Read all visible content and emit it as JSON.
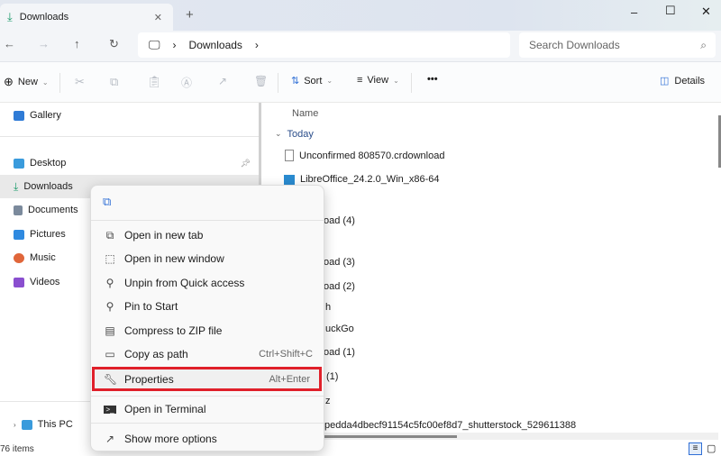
{
  "window": {
    "tab_title": "Downloads",
    "new_tab": "+",
    "minimize": "–",
    "maximize": "☐",
    "close": "✕"
  },
  "address": {
    "crumbs": [
      "Downloads"
    ],
    "search_placeholder": "Search Downloads"
  },
  "toolbar": {
    "new_label": "New",
    "sort_label": "Sort",
    "view_label": "View",
    "more": "•••",
    "details_label": "Details"
  },
  "sidebar": {
    "items": [
      {
        "label": "Gallery",
        "color": "#2f7bd6"
      },
      {
        "label": "Desktop",
        "color": "#3a9bdc"
      },
      {
        "label": "Downloads",
        "color": "#1a9a6a"
      },
      {
        "label": "Documents",
        "color": "#7b8a9c"
      },
      {
        "label": "Pictures",
        "color": "#2f8ae0"
      },
      {
        "label": "Music",
        "color": "#e0663a"
      },
      {
        "label": "Videos",
        "color": "#8a4fcf"
      }
    ],
    "this_pc": "This PC"
  },
  "content": {
    "column_name": "Name",
    "group": "Today",
    "rows": [
      "Unconfirmed 808570.crdownload",
      "LibreOffice_24.2.0_Win_x86-64",
      "oad (4)",
      "oad (3)",
      "oad (2)",
      "h",
      "uckGo",
      "oad (1)",
      "(1)",
      "z",
      "pedda4dbecf91154c5fc00ef8d7_shutterstock_529611388"
    ]
  },
  "status": {
    "items": "76 items"
  },
  "context_menu": {
    "items": [
      {
        "label": "Open in new tab",
        "icon": "new-tab-icon",
        "shortcut": ""
      },
      {
        "label": "Open in new window",
        "icon": "new-window-icon",
        "shortcut": ""
      },
      {
        "label": "Unpin from Quick access",
        "icon": "unpin-icon",
        "shortcut": ""
      },
      {
        "label": "Pin to Start",
        "icon": "pin-icon",
        "shortcut": ""
      },
      {
        "label": "Compress to ZIP file",
        "icon": "zip-icon",
        "shortcut": ""
      },
      {
        "label": "Copy as path",
        "icon": "copy-path-icon",
        "shortcut": "Ctrl+Shift+C"
      },
      {
        "label": "Properties",
        "icon": "wrench-icon",
        "shortcut": "Alt+Enter"
      },
      {
        "label": "Open in Terminal",
        "icon": "terminal-icon",
        "shortcut": ""
      },
      {
        "label": "Show more options",
        "icon": "more-options-icon",
        "shortcut": ""
      }
    ],
    "highlight_color": "#e0202a"
  }
}
